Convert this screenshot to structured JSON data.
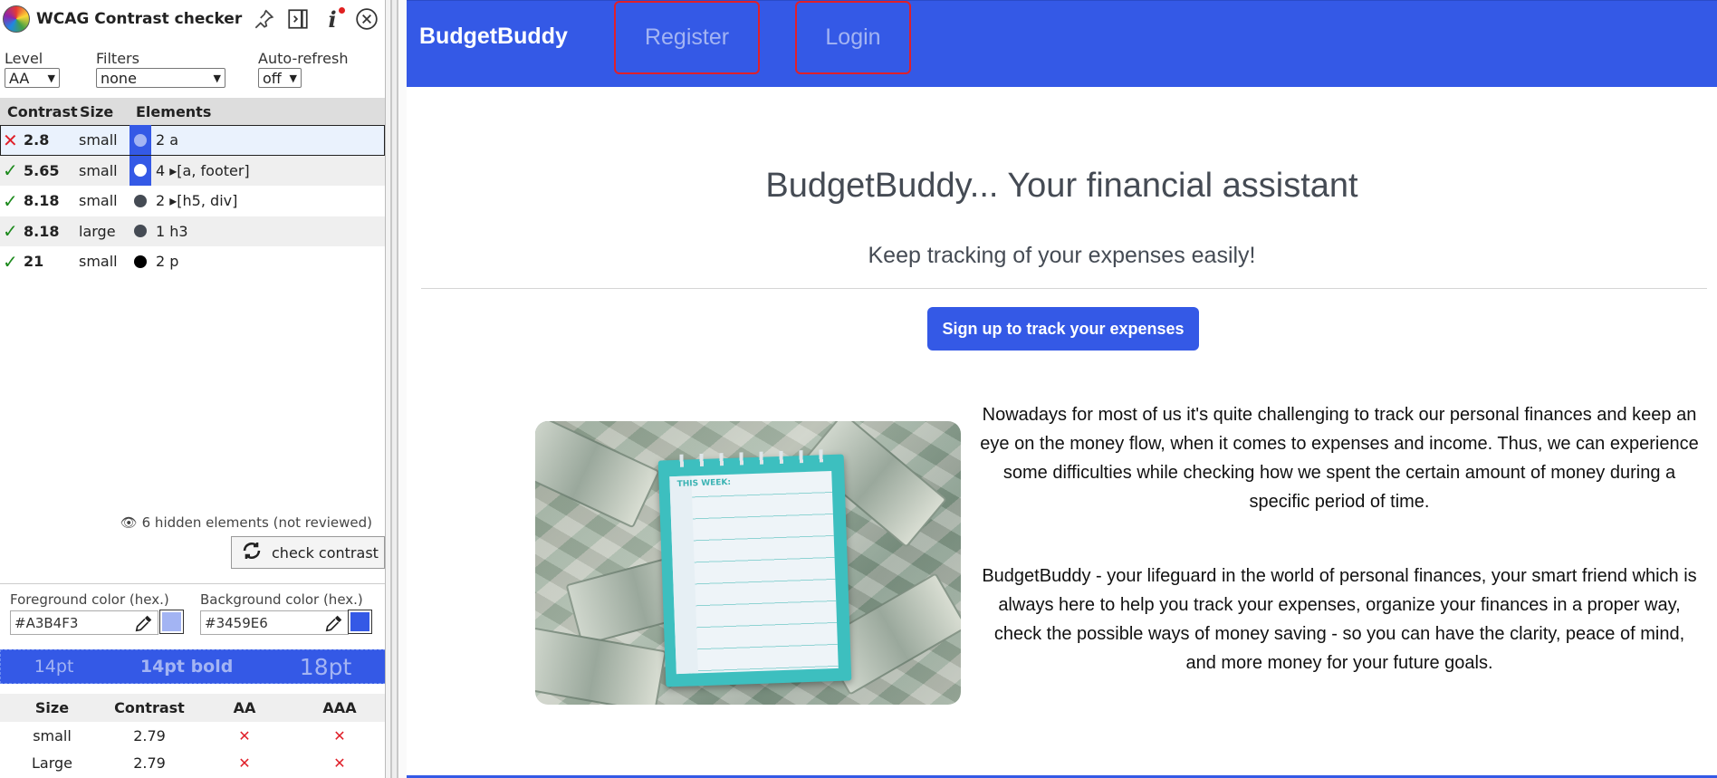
{
  "panel": {
    "title": "WCAG Contrast checker",
    "icons": [
      "pin-icon",
      "dock-icon",
      "info-icon",
      "close-icon"
    ],
    "filters": {
      "level_label": "Level",
      "level_value": "AA",
      "filters_label": "Filters",
      "filters_value": "none",
      "autorefresh_label": "Auto-refresh",
      "autorefresh_value": "off"
    },
    "table_headers": {
      "contrast": "Contrast",
      "size": "Size",
      "elements": "Elements"
    },
    "rows": [
      {
        "status": "fail",
        "mark": "✕",
        "ratio": "2.8",
        "size": "small",
        "color": "#A3B4F3",
        "bg": "#3459E6",
        "elements": "2 a"
      },
      {
        "status": "pass",
        "mark": "✓",
        "ratio": "5.65",
        "size": "small",
        "color": "#FFFFFF",
        "bg": "#3459E6",
        "elements": "4 ▸[a, footer]"
      },
      {
        "status": "pass",
        "mark": "✓",
        "ratio": "8.18",
        "size": "small",
        "color": "#454B54",
        "bg": "",
        "elements": "2 ▸[h5, div]"
      },
      {
        "status": "pass",
        "mark": "✓",
        "ratio": "8.18",
        "size": "large",
        "color": "#454B54",
        "bg": "",
        "elements": "1 h3"
      },
      {
        "status": "pass",
        "mark": "✓",
        "ratio": "21",
        "size": "small",
        "color": "#000000",
        "bg": "",
        "elements": "2 p"
      }
    ],
    "hidden_note": "6 hidden elements (not reviewed)",
    "check_button": "check contrast",
    "foreground": {
      "label": "Foreground color (hex.)",
      "value": "#A3B4F3"
    },
    "background": {
      "label": "Background color (hex.)",
      "value": "#3459E6"
    },
    "preview": {
      "small": "14pt",
      "bold": "14pt bold",
      "large": "18pt"
    },
    "results": {
      "headers": [
        "Size",
        "Contrast",
        "AA",
        "AAA"
      ],
      "rows": [
        {
          "size": "small",
          "contrast": "2.79",
          "aa": "✕",
          "aaa": "✕"
        },
        {
          "size": "Large",
          "contrast": "2.79",
          "aa": "✕",
          "aaa": "✕"
        }
      ]
    }
  },
  "site": {
    "brand": "BudgetBuddy",
    "nav": {
      "register": "Register",
      "login": "Login"
    },
    "hero_title": "BudgetBuddy... Your financial assistant",
    "hero_subtitle": "Keep tracking of your expenses easily!",
    "cta": "Sign up to track your expenses",
    "image_text": "THIS WEEK:",
    "paragraph1": "Nowadays for most of us it's quite challenging to track our personal finances and keep an eye on the money flow, when it comes to expenses and income. Thus, we can experience some difficulties while checking how we spent the certain amount of money during a specific period of time.",
    "paragraph2": "BudgetBuddy - your lifeguard in the world of personal finances, your smart friend which is always here to help you track your expenses, organize your finances in a proper way, check the possible ways of money saving - so you can have the clarity, peace of mind, and more money for your future goals.",
    "colors": {
      "primary": "#3459E6",
      "link_low_contrast": "#A3B4F3",
      "text": "#454B54"
    }
  }
}
